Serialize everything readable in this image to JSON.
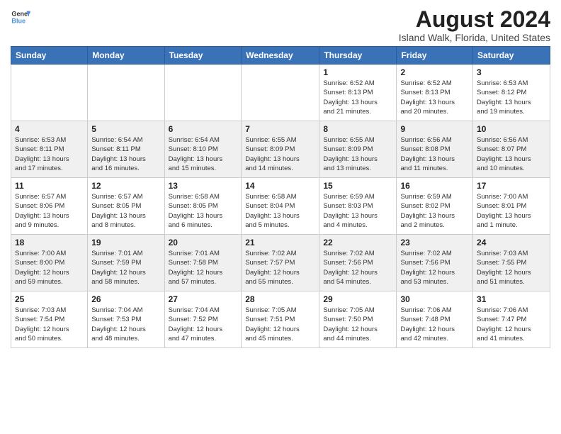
{
  "logo": {
    "text_general": "General",
    "text_blue": "Blue"
  },
  "header": {
    "title": "August 2024",
    "subtitle": "Island Walk, Florida, United States"
  },
  "calendar": {
    "days_of_week": [
      "Sunday",
      "Monday",
      "Tuesday",
      "Wednesday",
      "Thursday",
      "Friday",
      "Saturday"
    ],
    "weeks": [
      {
        "days": [
          {
            "number": "",
            "info": ""
          },
          {
            "number": "",
            "info": ""
          },
          {
            "number": "",
            "info": ""
          },
          {
            "number": "",
            "info": ""
          },
          {
            "number": "1",
            "info": "Sunrise: 6:52 AM\nSunset: 8:13 PM\nDaylight: 13 hours\nand 21 minutes."
          },
          {
            "number": "2",
            "info": "Sunrise: 6:52 AM\nSunset: 8:13 PM\nDaylight: 13 hours\nand 20 minutes."
          },
          {
            "number": "3",
            "info": "Sunrise: 6:53 AM\nSunset: 8:12 PM\nDaylight: 13 hours\nand 19 minutes."
          }
        ]
      },
      {
        "days": [
          {
            "number": "4",
            "info": "Sunrise: 6:53 AM\nSunset: 8:11 PM\nDaylight: 13 hours\nand 17 minutes."
          },
          {
            "number": "5",
            "info": "Sunrise: 6:54 AM\nSunset: 8:11 PM\nDaylight: 13 hours\nand 16 minutes."
          },
          {
            "number": "6",
            "info": "Sunrise: 6:54 AM\nSunset: 8:10 PM\nDaylight: 13 hours\nand 15 minutes."
          },
          {
            "number": "7",
            "info": "Sunrise: 6:55 AM\nSunset: 8:09 PM\nDaylight: 13 hours\nand 14 minutes."
          },
          {
            "number": "8",
            "info": "Sunrise: 6:55 AM\nSunset: 8:09 PM\nDaylight: 13 hours\nand 13 minutes."
          },
          {
            "number": "9",
            "info": "Sunrise: 6:56 AM\nSunset: 8:08 PM\nDaylight: 13 hours\nand 11 minutes."
          },
          {
            "number": "10",
            "info": "Sunrise: 6:56 AM\nSunset: 8:07 PM\nDaylight: 13 hours\nand 10 minutes."
          }
        ]
      },
      {
        "days": [
          {
            "number": "11",
            "info": "Sunrise: 6:57 AM\nSunset: 8:06 PM\nDaylight: 13 hours\nand 9 minutes."
          },
          {
            "number": "12",
            "info": "Sunrise: 6:57 AM\nSunset: 8:05 PM\nDaylight: 13 hours\nand 8 minutes."
          },
          {
            "number": "13",
            "info": "Sunrise: 6:58 AM\nSunset: 8:05 PM\nDaylight: 13 hours\nand 6 minutes."
          },
          {
            "number": "14",
            "info": "Sunrise: 6:58 AM\nSunset: 8:04 PM\nDaylight: 13 hours\nand 5 minutes."
          },
          {
            "number": "15",
            "info": "Sunrise: 6:59 AM\nSunset: 8:03 PM\nDaylight: 13 hours\nand 4 minutes."
          },
          {
            "number": "16",
            "info": "Sunrise: 6:59 AM\nSunset: 8:02 PM\nDaylight: 13 hours\nand 2 minutes."
          },
          {
            "number": "17",
            "info": "Sunrise: 7:00 AM\nSunset: 8:01 PM\nDaylight: 13 hours\nand 1 minute."
          }
        ]
      },
      {
        "days": [
          {
            "number": "18",
            "info": "Sunrise: 7:00 AM\nSunset: 8:00 PM\nDaylight: 12 hours\nand 59 minutes."
          },
          {
            "number": "19",
            "info": "Sunrise: 7:01 AM\nSunset: 7:59 PM\nDaylight: 12 hours\nand 58 minutes."
          },
          {
            "number": "20",
            "info": "Sunrise: 7:01 AM\nSunset: 7:58 PM\nDaylight: 12 hours\nand 57 minutes."
          },
          {
            "number": "21",
            "info": "Sunrise: 7:02 AM\nSunset: 7:57 PM\nDaylight: 12 hours\nand 55 minutes."
          },
          {
            "number": "22",
            "info": "Sunrise: 7:02 AM\nSunset: 7:56 PM\nDaylight: 12 hours\nand 54 minutes."
          },
          {
            "number": "23",
            "info": "Sunrise: 7:02 AM\nSunset: 7:56 PM\nDaylight: 12 hours\nand 53 minutes."
          },
          {
            "number": "24",
            "info": "Sunrise: 7:03 AM\nSunset: 7:55 PM\nDaylight: 12 hours\nand 51 minutes."
          }
        ]
      },
      {
        "days": [
          {
            "number": "25",
            "info": "Sunrise: 7:03 AM\nSunset: 7:54 PM\nDaylight: 12 hours\nand 50 minutes."
          },
          {
            "number": "26",
            "info": "Sunrise: 7:04 AM\nSunset: 7:53 PM\nDaylight: 12 hours\nand 48 minutes."
          },
          {
            "number": "27",
            "info": "Sunrise: 7:04 AM\nSunset: 7:52 PM\nDaylight: 12 hours\nand 47 minutes."
          },
          {
            "number": "28",
            "info": "Sunrise: 7:05 AM\nSunset: 7:51 PM\nDaylight: 12 hours\nand 45 minutes."
          },
          {
            "number": "29",
            "info": "Sunrise: 7:05 AM\nSunset: 7:50 PM\nDaylight: 12 hours\nand 44 minutes."
          },
          {
            "number": "30",
            "info": "Sunrise: 7:06 AM\nSunset: 7:48 PM\nDaylight: 12 hours\nand 42 minutes."
          },
          {
            "number": "31",
            "info": "Sunrise: 7:06 AM\nSunset: 7:47 PM\nDaylight: 12 hours\nand 41 minutes."
          }
        ]
      }
    ]
  }
}
